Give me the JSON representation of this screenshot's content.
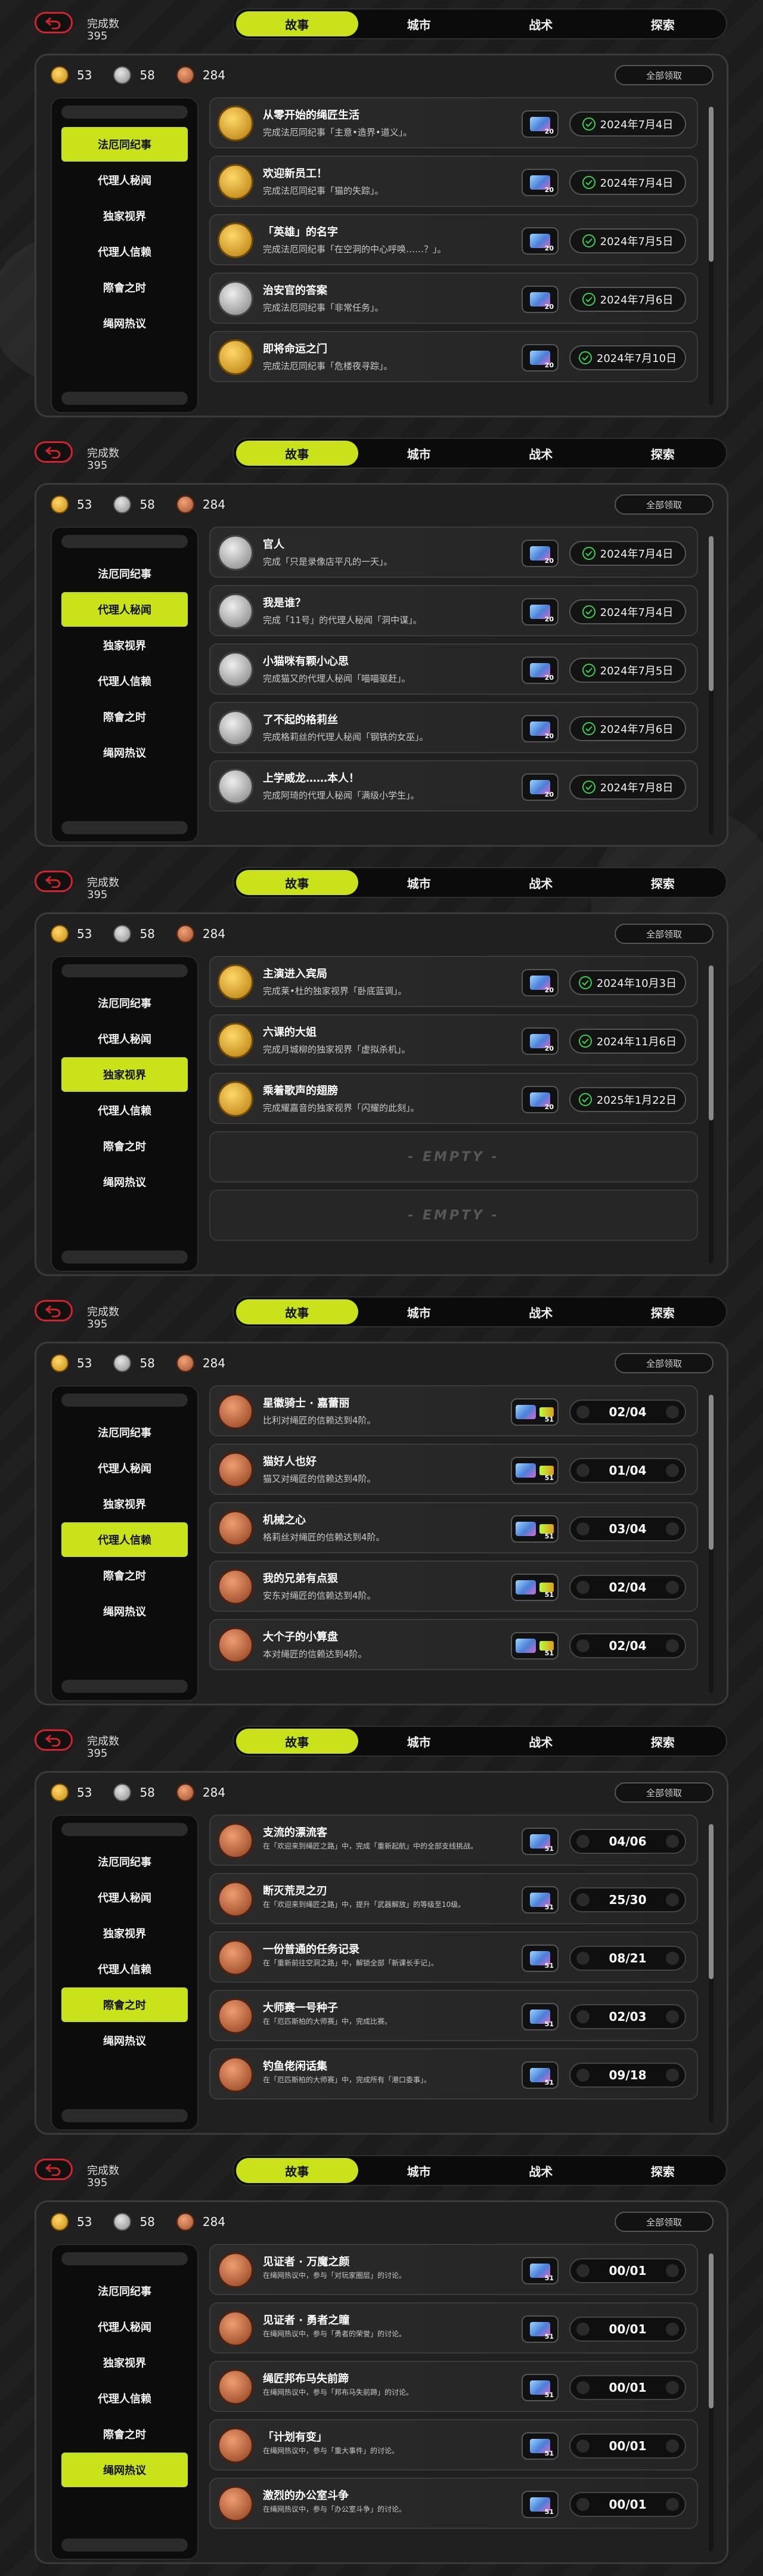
{
  "header": {
    "count_label": "完成数",
    "count_value": "395"
  },
  "tabs": [
    "故事",
    "城市",
    "战术",
    "探索"
  ],
  "currency": {
    "gold": "53",
    "silver": "58",
    "bronze": "284"
  },
  "claim_all_label": "全部领取",
  "sidebar_items": [
    "法厄同纪事",
    "代理人秘闻",
    "独家视界",
    "代理人信赖",
    "際會之时",
    "绳网热议"
  ],
  "reward_qty": "20",
  "reward_qty2": "51",
  "empty_label": "- EMPTY -",
  "colors": {
    "accent": "#c9e21a",
    "back_border": "#d0252c",
    "check": "#3ccf4e"
  },
  "screens": [
    {
      "active_sidebar": 0,
      "rows": [
        {
          "icon": "gold",
          "title": "从零开始的绳匠生活",
          "desc": "完成法厄同纪事「主意•造界•道义」。",
          "date": "2024年7月4日"
        },
        {
          "icon": "gold",
          "title": "欢迎新员工！",
          "desc": "完成法厄同纪事「猫的失踪」。",
          "date": "2024年7月4日"
        },
        {
          "icon": "gold",
          "title": "「英雄」的名字",
          "desc": "完成法厄同纪事「在空洞的中心呼唤……？」。",
          "date": "2024年7月5日"
        },
        {
          "icon": "silver",
          "title": "治安官的答案",
          "desc": "完成法厄同纪事「非常任务」。",
          "date": "2024年7月6日"
        },
        {
          "icon": "gold",
          "title": "即将命运之门",
          "desc": "完成法厄同纪事「危楼夜寻踪」。",
          "date": "2024年7月10日"
        }
      ]
    },
    {
      "active_sidebar": 1,
      "rows": [
        {
          "icon": "silver",
          "title": "官人",
          "desc": "完成「只是录像店平凡的一天」。",
          "date": "2024年7月4日"
        },
        {
          "icon": "silver",
          "title": "我是谁？",
          "desc": "完成「11号」的代理人秘闻「洞中谋」。",
          "date": "2024年7月4日"
        },
        {
          "icon": "silver",
          "title": "小猫咪有颗小心思",
          "desc": "完成猫又的代理人秘闻「喵喵驱赶」。",
          "date": "2024年7月5日"
        },
        {
          "icon": "silver",
          "title": "了不起的格莉丝",
          "desc": "完成格莉丝的代理人秘闻「钢铁的女巫」。",
          "date": "2024年7月6日"
        },
        {
          "icon": "silver",
          "title": "上学威龙……本人！",
          "desc": "完成阿琦的代理人秘闻「满级小学生」。",
          "date": "2024年7月8日"
        }
      ]
    },
    {
      "active_sidebar": 2,
      "rows": [
        {
          "icon": "gold",
          "title": "主演进入宾局",
          "desc": "完成莱•杜的独家视界「卧底蓝调」。",
          "date": "2024年10月3日"
        },
        {
          "icon": "gold",
          "title": "六课的大姐",
          "desc": "完成月城柳的独家视界「虚拟杀机」。",
          "date": "2024年11月6日"
        },
        {
          "icon": "gold",
          "title": "乘着歌声的翅膀",
          "desc": "完成耀嘉音的独家视界「闪耀的此刻」。",
          "date": "2025年1月22日"
        }
      ]
    },
    {
      "active_sidebar": 3,
      "rows": [
        {
          "icon": "bronze",
          "title": "星徽骑士 · 嘉蕾丽",
          "desc": "比利对绳匠的信赖达到4阶。",
          "progress": "02/04"
        },
        {
          "icon": "bronze",
          "title": "猫好人也好",
          "desc": "猫又对绳匠的信赖达到4阶。",
          "progress": "01/04"
        },
        {
          "icon": "bronze",
          "title": "机械之心",
          "desc": "格莉丝对绳匠的信赖达到4阶。",
          "progress": "03/04"
        },
        {
          "icon": "bronze",
          "title": "我的兄弟有点狠",
          "desc": "安东对绳匠的信赖达到4阶。",
          "progress": "02/04"
        },
        {
          "icon": "bronze",
          "title": "大个子的小算盘",
          "desc": "本对绳匠的信赖达到4阶。",
          "progress": "02/04"
        }
      ]
    },
    {
      "active_sidebar": 4,
      "rows": [
        {
          "icon": "bronze",
          "title": "支流的漂流客",
          "desc": "在「欢迎来到绳匠之路」中，完成「重新起航」中的全部支线挑战。",
          "progress": "04/06"
        },
        {
          "icon": "bronze",
          "title": "断灭荒灵之刃",
          "desc": "在「欢迎来到绳匠之路」中，提升「武器解放」的等级至10级。",
          "progress": "25/30"
        },
        {
          "icon": "bronze",
          "title": "一份普通的任务记录",
          "desc": "在「重新前往空洞之路」中，解锁全部「新课长手记」。",
          "progress": "08/21"
        },
        {
          "icon": "bronze",
          "title": "大师赛一号种子",
          "desc": "在「厄匹斯柏的大师赛」中，完成比赛。",
          "progress": "02/03"
        },
        {
          "icon": "bronze",
          "title": "钓鱼佬闲话集",
          "desc": "在「厄匹斯柏的大师赛」中，完成所有「港口委事」。",
          "progress": "09/18"
        }
      ]
    },
    {
      "active_sidebar": 5,
      "rows": [
        {
          "icon": "bronze",
          "title": "见证者 · 万魔之颜",
          "desc": "在绳网热议中，参与「对玩家圈层」的讨论。",
          "progress": "00/01"
        },
        {
          "icon": "bronze",
          "title": "见证者 · 勇者之瞳",
          "desc": "在绳网热议中，参与「勇者的荣誉」的讨论。",
          "progress": "00/01"
        },
        {
          "icon": "bronze",
          "title": "绳匠邦布马失前蹄",
          "desc": "在绳网热议中，参与「邦布马失前蹄」的讨论。",
          "progress": "00/01"
        },
        {
          "icon": "bronze",
          "title": "「计划有变」",
          "desc": "在绳网热议中，参与「重大事件」的讨论。",
          "progress": "00/01"
        },
        {
          "icon": "bronze",
          "title": "激烈的办公室斗争",
          "desc": "在绳网热议中，参与「办公室斗争」的讨论。",
          "progress": "00/01"
        }
      ]
    }
  ]
}
